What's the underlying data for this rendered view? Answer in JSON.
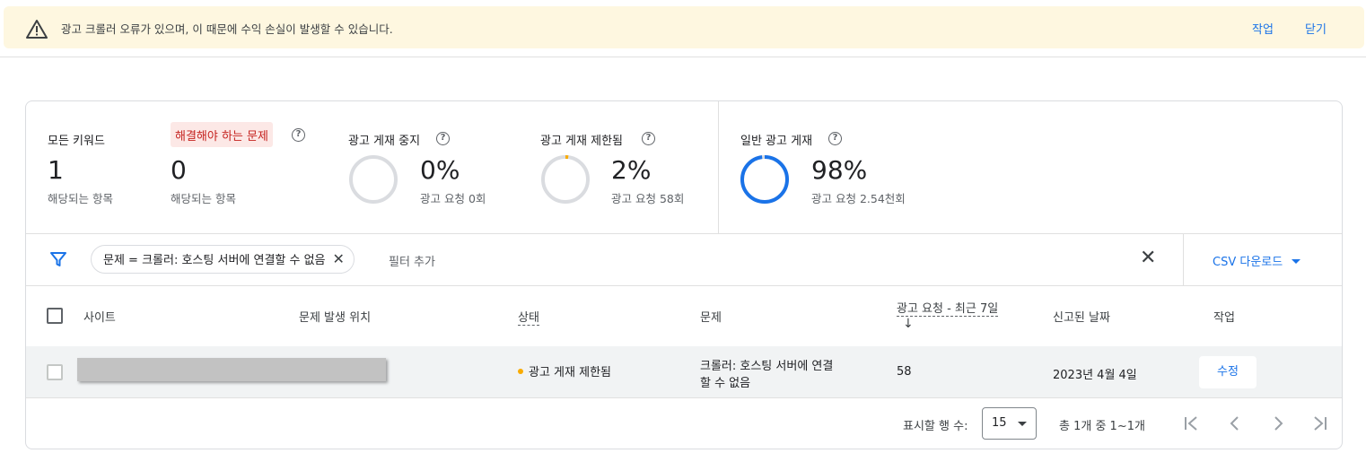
{
  "banner": {
    "message": "광고 크롤러 오류가 있으며, 이 때문에 수익 손실이 발생할 수 있습니다.",
    "action_label": "작업",
    "close_label": "닫기",
    "icon": "warning-icon"
  },
  "stats": {
    "all_keywords": {
      "label": "모든 키워드",
      "value": "1",
      "sub": "해당되는 항목"
    },
    "issues": {
      "label": "해결해야 하는 문제",
      "value": "0",
      "sub": "해당되는 항목"
    },
    "paused": {
      "label": "광고 게재 중지",
      "percent": "0%",
      "sub": "광고 요청 0회",
      "fraction": 0.0
    },
    "limited": {
      "label": "광고 게재 제한됨",
      "percent": "2%",
      "sub": "광고 요청 58회",
      "fraction": 0.02
    },
    "normal": {
      "label": "일반 광고 게재",
      "percent": "98%",
      "sub": "광고 요청 2.54천회",
      "fraction": 0.98
    },
    "help_glyph": "?"
  },
  "filter": {
    "chip_label": "문제 = 크롤러: 호스팅 서버에 연결할 수 없음",
    "add_label": "필터 추가",
    "csv_label": "CSV 다운로드"
  },
  "table": {
    "headers": {
      "site": "사이트",
      "location": "문제 발생 위치",
      "status": "상태",
      "issue": "문제",
      "requests": "광고 요청 - 최근 7일",
      "sort_arrow": "↓",
      "date": "신고된 날짜",
      "action": "작업"
    },
    "rows": [
      {
        "status": "광고 게재 제한됨",
        "issue_line1": "크롤러: 호스팅 서버에 연결",
        "issue_line2": "할 수 없음",
        "requests": "58",
        "date": "2023년 4월 4일",
        "action": "수정"
      }
    ]
  },
  "footer": {
    "rows_label": "표시할 행 수:",
    "rows_value": "15",
    "range": "총 1개 중 1~1개"
  },
  "colors": {
    "accent": "#1a73e8",
    "issue_red": "#c5221f",
    "issue_bg": "#fce8e6",
    "limited": "#f9ab00",
    "ring_gray": "#dadce0",
    "banner_bg": "#fef7e0"
  }
}
